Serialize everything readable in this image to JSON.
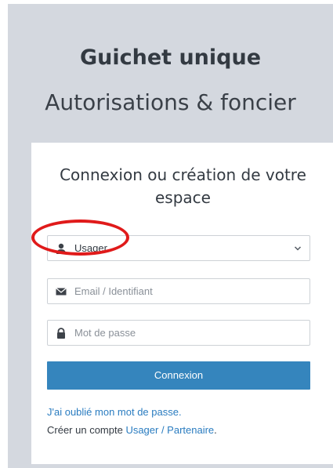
{
  "header": {
    "title": "Guichet unique",
    "subtitle": "Autorisations & foncier"
  },
  "login": {
    "heading": "Connexion ou création de votre espace",
    "user_type": {
      "selected": "Usager",
      "icon": "user-icon"
    },
    "email": {
      "placeholder": "Email / Identifiant",
      "icon": "envelope-icon"
    },
    "password": {
      "placeholder": "Mot de passe",
      "icon": "lock-icon"
    },
    "submit_label": "Connexion",
    "forgot_link": "J'ai oublié mon mot de passe.",
    "create_prefix": "Créer un compte ",
    "create_link": "Usager / Partenaire",
    "create_suffix": "."
  },
  "colors": {
    "background": "#d4d8df",
    "button": "#3585bd",
    "link": "#2a7cc0",
    "annotation": "#e01a1a"
  }
}
